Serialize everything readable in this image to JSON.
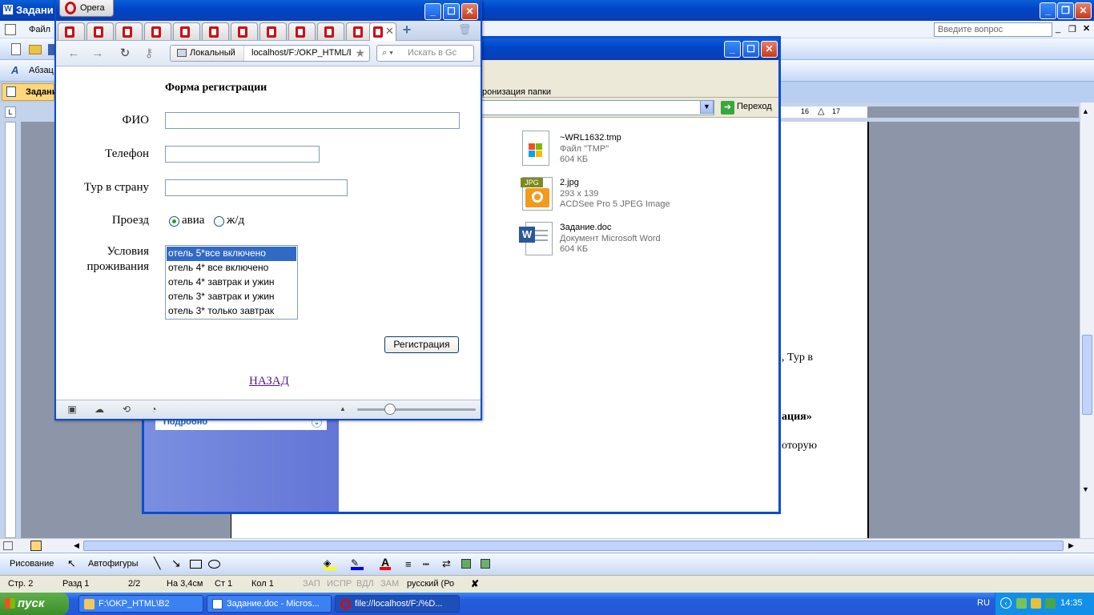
{
  "word": {
    "title": "Задани",
    "menu": {
      "file": "Файл"
    },
    "style_box": "Абзац",
    "doc_tab": "Задани",
    "ask_placeholder": "Введите вопрос",
    "doc_fragments": [
      ", Тур в",
      "ация»",
      "оторую"
    ],
    "ruler_marks": [
      "16",
      "17"
    ],
    "status": {
      "page": "Стр. 2",
      "section": "Разд 1",
      "pages": "2/2",
      "at": "На 3,4см",
      "line": "Ст 1",
      "col": "Кол 1",
      "rec": "ЗАП",
      "trk": "ИСПР",
      "ext": "ВДЛ",
      "ovr": "ЗАМ",
      "lang": "русский (Ро"
    },
    "drawing_toolbar": {
      "draw_menu": "Рисование",
      "autoshapes": "Автофигуры"
    }
  },
  "explorer": {
    "cmd_text": "ронизация папки",
    "go_label": "Переход",
    "detail_label": "Подробно",
    "files": [
      {
        "name": "~WRL1632.tmp",
        "meta1": "Файл \"TMP\"",
        "meta2": "604 КБ",
        "icon": "tmp-file-icon"
      },
      {
        "name": "2.jpg",
        "meta1": "293 x 139",
        "meta2": "ACDSee Pro 5 JPEG Image",
        "icon": "jpg-file-icon",
        "badge": "JPG"
      },
      {
        "name": "Задание.doc",
        "meta1": "Документ Microsoft Word",
        "meta2": "604 КБ",
        "icon": "word-doc-icon"
      }
    ]
  },
  "opera": {
    "menu_label": "Opera",
    "tab_count": 11,
    "address": {
      "security": "Локальный",
      "url": "localhost/F:/OKP_HTML/B"
    },
    "search_placeholder": "Искать в Gc",
    "form": {
      "title": "Форма регистрации",
      "fio_label": "ФИО",
      "phone_label": "Телефон",
      "tour_label": "Тур в страну",
      "travel_label": "Проезд",
      "travel_options": [
        {
          "label": "авиа",
          "checked": true
        },
        {
          "label": "ж/д",
          "checked": false
        }
      ],
      "conditions_label_1": "Условия",
      "conditions_label_2": "проживания",
      "conditions_options": [
        "отель 5*все включено",
        "отель 4* все включено",
        "отель 4* завтрак и ужин",
        "отель 3* завтрак и ужин",
        "отель 3* только завтрак"
      ],
      "selected_condition": 0,
      "submit_label": "Регистрация",
      "back_link": "НАЗАД"
    }
  },
  "taskbar": {
    "start_label": "пуск",
    "tasks": [
      {
        "label": "F:\\OKP_HTML\\B2",
        "icon": "folder-icon",
        "active": false
      },
      {
        "label": "Задание.doc - Micros...",
        "icon": "word-icon",
        "active": false
      },
      {
        "label": "file://localhost/F:/%D...",
        "icon": "opera-icon",
        "active": true
      }
    ],
    "language": "RU",
    "time": "14:35"
  },
  "colors": {
    "xp_blue": "#0046C8",
    "selection": "#316AC5",
    "opera_red": "#CC0F16",
    "link_visited": "#551A8B"
  }
}
